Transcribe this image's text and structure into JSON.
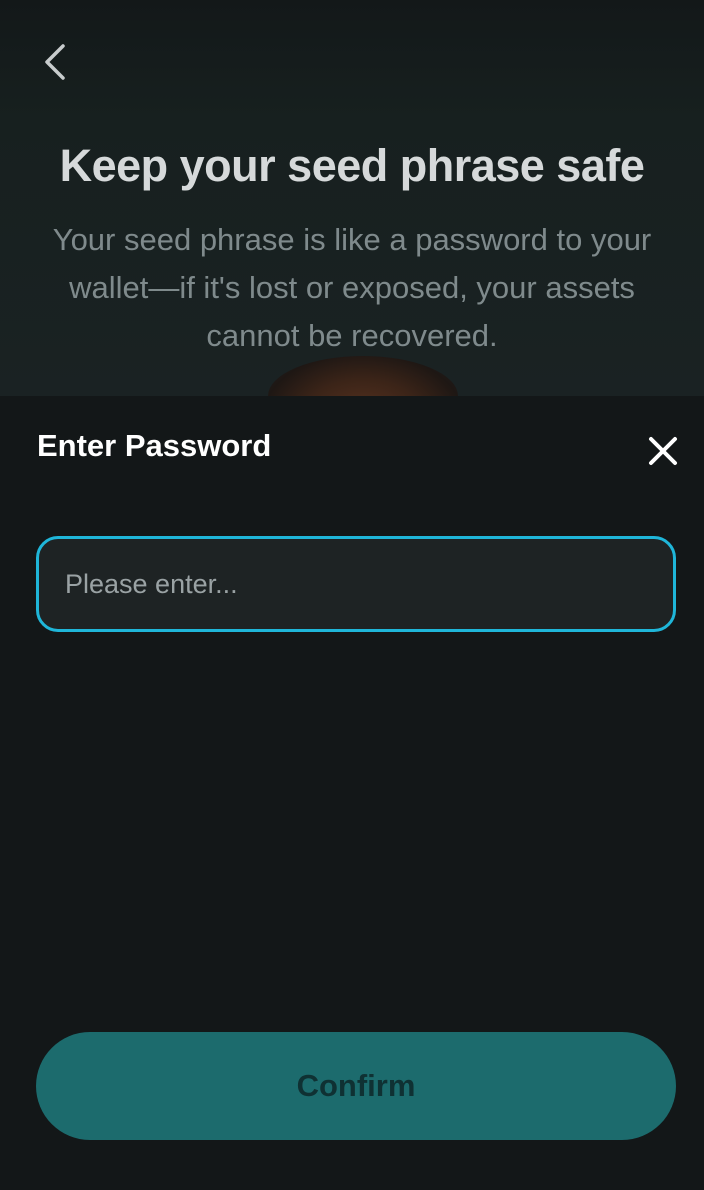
{
  "background_page": {
    "back_icon": "chevron-left-icon",
    "title": "Keep your seed phrase safe",
    "subtitle": "Your seed phrase is like a password to your wallet—if it's lost or exposed, your assets cannot be recovered."
  },
  "sheet": {
    "title": "Enter Password",
    "close_icon": "close-icon",
    "password_field": {
      "value": "",
      "placeholder": "Please enter..."
    },
    "confirm_label": "Confirm"
  },
  "colors": {
    "background": "#131718",
    "field_border": "#1fb6d9",
    "field_background": "#1e2324",
    "confirm_background": "#1c6b6d",
    "confirm_text": "#0f3133"
  }
}
